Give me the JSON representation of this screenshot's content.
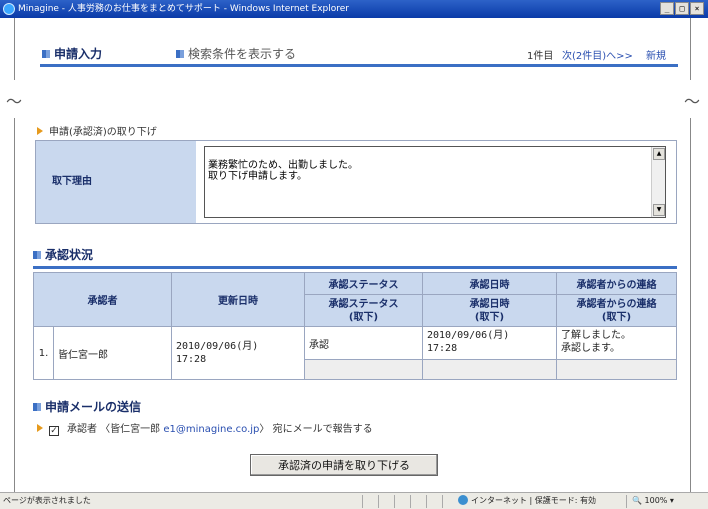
{
  "window": {
    "title": "Minagine - 人事労務のお仕事をまとめてサポート - Windows Internet Explorer",
    "minimize": "_",
    "maximize": "□",
    "close": "×"
  },
  "header": {
    "title": "申請入力",
    "show_conditions": "検索条件を表示する",
    "count": "1件目",
    "next": "次(2件目)へ>>",
    "new": "新規"
  },
  "break_mark": "～",
  "withdrawal": {
    "crumb": "申請(承認済)の取り下げ",
    "reason_label": "取下理由",
    "reason_text": "業務繁忙のため、出勤しました。\n取り下げ申請します。"
  },
  "approval": {
    "heading": "承認状況",
    "headers": {
      "approver": "承認者",
      "updated": "更新日時",
      "status": "承認ステータス",
      "status_wd": "承認ステータス\n(取下)",
      "date": "承認日時",
      "date_wd": "承認日時\n(取下)",
      "contact": "承認者からの連絡",
      "contact_wd": "承認者からの連絡\n(取下)"
    },
    "rows": [
      {
        "no": "1.",
        "approver": "皆仁宮一郎",
        "updated": "2010/09/06(月)\n17:28",
        "status": "承認",
        "date": "2010/09/06(月)\n17:28",
        "contact": "了解しました。\n承認します。",
        "status_wd": "",
        "date_wd": "",
        "contact_wd": ""
      }
    ]
  },
  "mail": {
    "heading": "申請メールの送信",
    "checkbox_mark": "✓",
    "text_before": "承認者 〈皆仁宮一郎 ",
    "email": "e1@minagine.co.jp",
    "text_after": "〉 宛にメールで報告する"
  },
  "actions": {
    "withdraw_button": "承認済の申請を取り下げる"
  },
  "statusbar": {
    "left": "ページが表示されました",
    "zone": "インターネット | 保護モード: 有効",
    "zoom": "100%"
  },
  "colors": {
    "accent_blue": "#3b6fc4",
    "header_cell": "#c9d8ee",
    "bullet_orange": "#e69a1d"
  }
}
